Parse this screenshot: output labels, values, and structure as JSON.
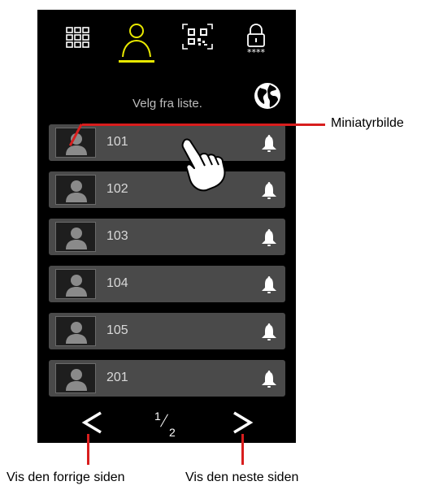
{
  "topnav": {
    "items": [
      {
        "icon": "grid-icon"
      },
      {
        "icon": "person-icon",
        "active": true
      },
      {
        "icon": "qr-code-icon"
      },
      {
        "icon": "lock-pin-icon"
      }
    ],
    "active_color": "#e8e800"
  },
  "subtitle": "Velg fra liste.",
  "list": {
    "rows": [
      {
        "label": "101"
      },
      {
        "label": "102"
      },
      {
        "label": "103"
      },
      {
        "label": "104"
      },
      {
        "label": "105"
      },
      {
        "label": "201"
      }
    ]
  },
  "pager": {
    "current": "1",
    "total": "2"
  },
  "annotations": {
    "thumbnail": "Miniatyrbilde",
    "prev": "Vis den forrige siden",
    "next": "Vis den neste siden",
    "line_color": "#d81e1e"
  }
}
